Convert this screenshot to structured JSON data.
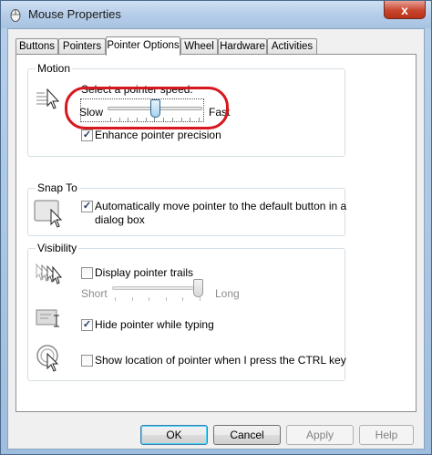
{
  "window": {
    "title": "Mouse Properties",
    "close_glyph": "x"
  },
  "tabs": [
    {
      "label": "Buttons"
    },
    {
      "label": "Pointers"
    },
    {
      "label": "Pointer Options"
    },
    {
      "label": "Wheel"
    },
    {
      "label": "Hardware"
    },
    {
      "label": "Activities"
    }
  ],
  "motion": {
    "group_label": "Motion",
    "speed_label": "Select a pointer speed:",
    "slow_label": "Slow",
    "fast_label": "Fast",
    "speed_value_fraction": 0.5,
    "precision_label": "Enhance pointer precision",
    "precision_checked": true
  },
  "snap_to": {
    "group_label": "Snap To",
    "line1": "Automatically move pointer to the default button in a",
    "line2": "dialog box",
    "checked": true
  },
  "visibility": {
    "group_label": "Visibility",
    "trails_label": "Display pointer trails",
    "trails_checked": false,
    "short_label": "Short",
    "long_label": "Long",
    "trail_value_fraction": 1.0,
    "hide_label": "Hide pointer while typing",
    "hide_checked": true,
    "ctrl_label": "Show location of pointer when I press the CTRL key",
    "ctrl_checked": false
  },
  "buttons": {
    "ok": "OK",
    "cancel": "Cancel",
    "apply": "Apply",
    "help": "Help"
  },
  "colors": {
    "highlight_ring": "#d8161d",
    "title_bar": "#b6cde8"
  }
}
